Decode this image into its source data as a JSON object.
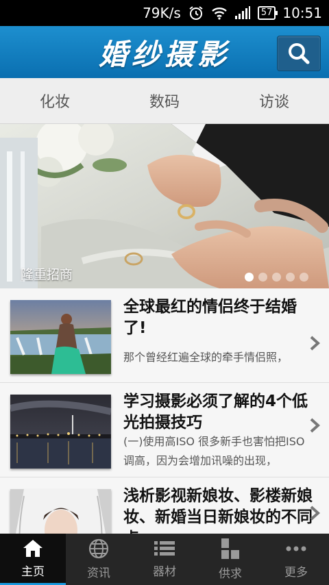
{
  "status_bar": {
    "speed": "79K/s",
    "battery": "57",
    "time": "10:51"
  },
  "header": {
    "title": "婚纱摄影"
  },
  "tabs": [
    {
      "label": "化妆"
    },
    {
      "label": "数码"
    },
    {
      "label": "访谈"
    }
  ],
  "banner": {
    "caption": "隆重招商",
    "slide_count": 5,
    "active_slide": 1
  },
  "articles": [
    {
      "title": "全球最红的情侣终于结婚了!",
      "description": "那个曾经红遍全球的牵手情侣照，"
    },
    {
      "title": "学习摄影必须了解的4个低光拍摄技巧",
      "description": "(一)使用高ISO 很多新手也害怕把ISO调高，因为会增加讯噪的出现，"
    },
    {
      "title": "浅析影视新娘妆、影楼新娘妆、新婚当日新娘妆的不同点",
      "description": ""
    }
  ],
  "bottom_nav": [
    {
      "label": "主页",
      "icon": "home-icon",
      "active": true
    },
    {
      "label": "资讯",
      "icon": "globe-icon",
      "active": false
    },
    {
      "label": "器材",
      "icon": "list-icon",
      "active": false
    },
    {
      "label": "供求",
      "icon": "grid-icon",
      "active": false
    },
    {
      "label": "更多",
      "icon": "more-icon",
      "active": false
    }
  ],
  "colors": {
    "header_blue": "#0a6fb0",
    "active_nav_accent": "#1a9be0"
  }
}
